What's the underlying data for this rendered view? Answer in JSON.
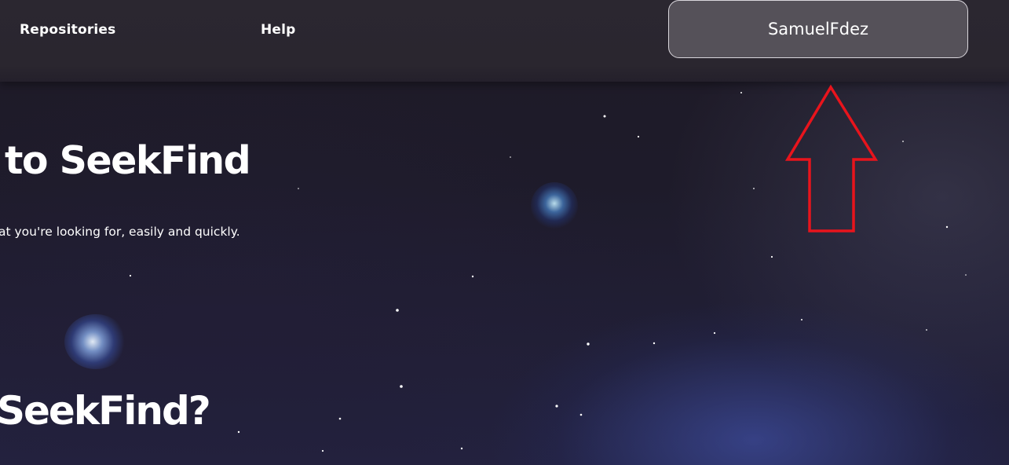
{
  "nav": {
    "repositories_label": "Repositories",
    "help_label": "Help",
    "user_label": "SamuelFdez"
  },
  "hero": {
    "title": "to SeekFind",
    "subtitle": "at you're looking for, easily and quickly."
  },
  "section": {
    "title": "SeekFind?"
  },
  "colors": {
    "annotation_arrow": "#e8141c",
    "nav_background": "#2a262f",
    "text": "#ffffff"
  },
  "icons": {
    "annotation": "up-arrow-annotation-icon"
  }
}
